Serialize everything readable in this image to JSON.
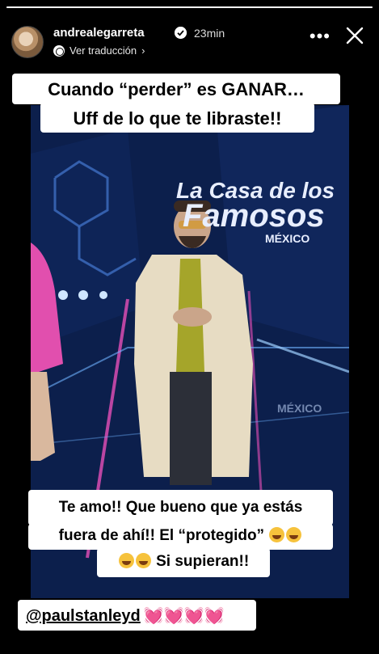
{
  "story": {
    "progress": 1.0
  },
  "header": {
    "username": "andrealegarreta",
    "time": "23min",
    "translate_label": "Ver traducción",
    "translate_chevron": "›",
    "more_label": "•••",
    "icons": [
      "avatar",
      "verified-badge-icon",
      "globe-icon",
      "more-icon",
      "close-icon"
    ]
  },
  "caption_top": {
    "line1": "Cuando “perder” es GANAR…",
    "line2": "Uff de lo que te libraste!!"
  },
  "photo_sign": {
    "line1": "La Casa de los",
    "line2": "Famosos",
    "line3": "MÉXICO",
    "floor_sign": "MÉXICO"
  },
  "caption_bottom": {
    "line1": "Te amo!! Que bueno que ya estás",
    "line2": "fuera de ahí!! El “protegido”",
    "line3": "Si supieran!!"
  },
  "mention": {
    "handle": "@paulstanleyd",
    "hearts": "💓💓💓💓"
  },
  "colors": {
    "background": "#000000",
    "caption_bg": "#ffffff",
    "accent_hearts": "#e56bd6"
  }
}
